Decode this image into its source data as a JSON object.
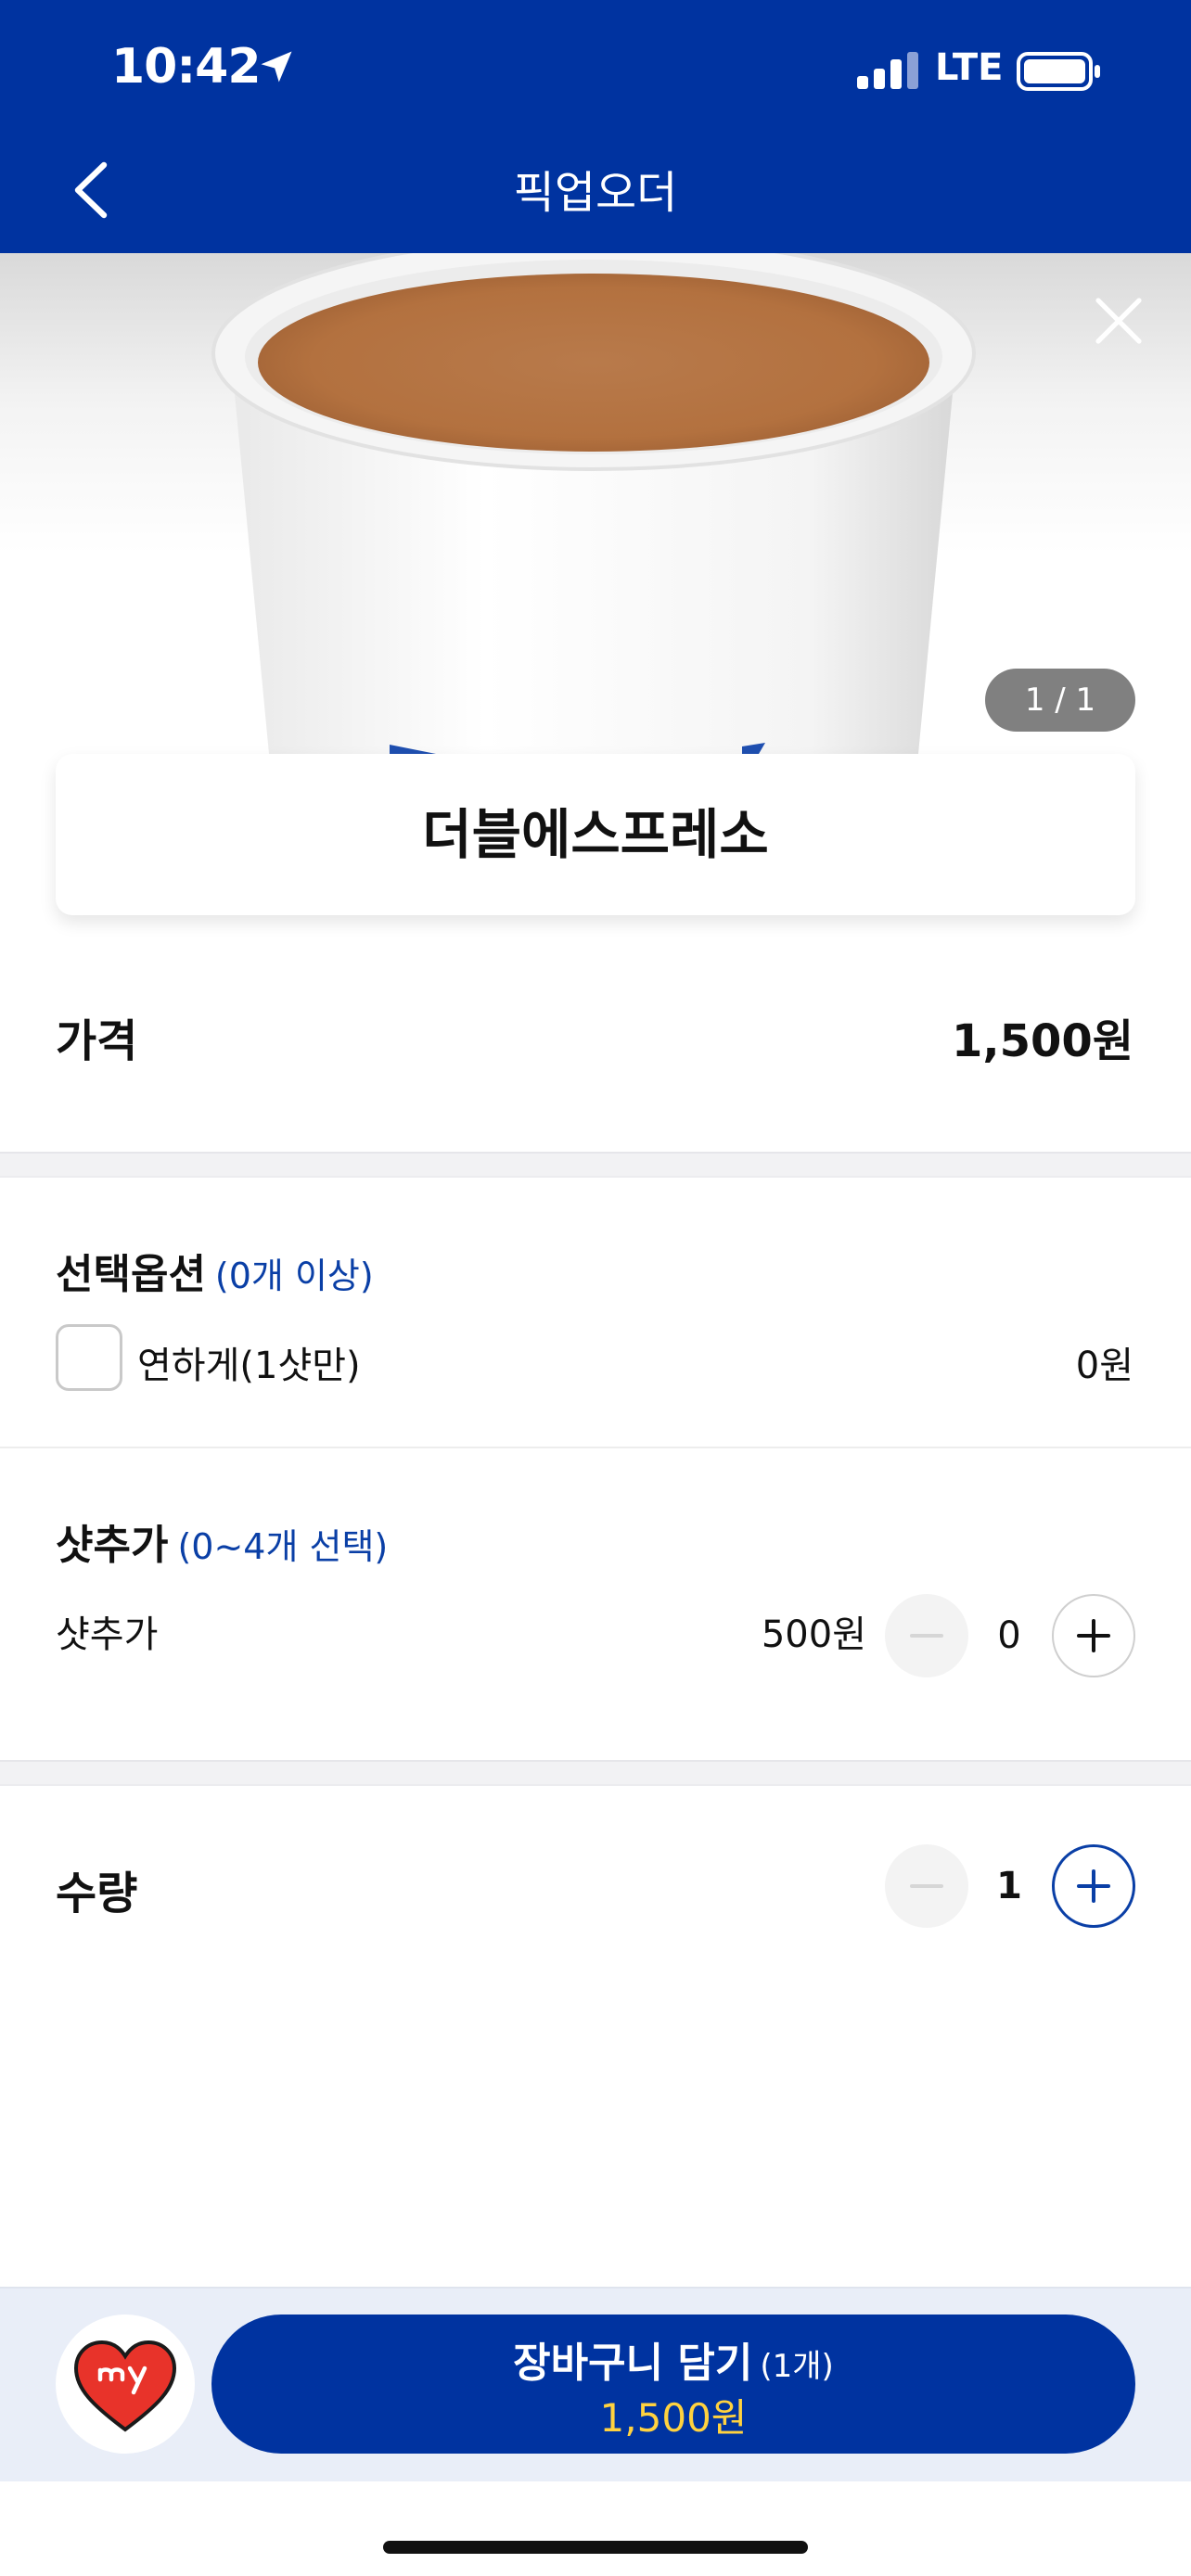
{
  "status_bar": {
    "time": "10:42",
    "network": "LTE"
  },
  "nav": {
    "title": "픽업오더"
  },
  "gallery": {
    "counter": "1 / 1"
  },
  "product": {
    "name": "더블에스프레소"
  },
  "price": {
    "label": "가격",
    "value": "1,500원"
  },
  "options": {
    "title": "선택옵션",
    "subtitle": "(0개 이상)",
    "items": [
      {
        "label": "연하게(1샷만)",
        "price": "0원",
        "checked": false
      }
    ]
  },
  "extra_shot": {
    "title": "샷추가",
    "subtitle": "(0~4개 선택)",
    "label": "샷추가",
    "price": "500원",
    "count": "0"
  },
  "quantity": {
    "label": "수량",
    "value": "1"
  },
  "cart": {
    "label": "장바구니 담기",
    "count": "(1개)",
    "total": "1,500원"
  },
  "colors": {
    "brand_blue": "#0033a0",
    "accent_blue": "#0a3fa6",
    "price_yellow": "#ffd23f",
    "heart_red": "#e8332a"
  },
  "icons": [
    "location-arrow-icon",
    "signal-icon",
    "battery-icon",
    "back-chevron-icon",
    "close-icon",
    "minus-icon",
    "plus-icon",
    "my-heart-icon"
  ]
}
